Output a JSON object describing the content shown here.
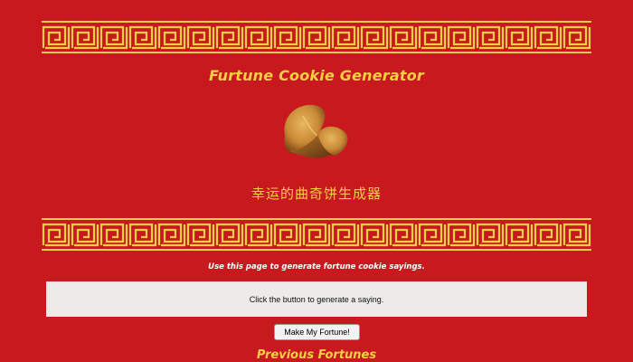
{
  "page": {
    "title": "Furtune Cookie Generator",
    "chinese_title": "幸运的曲奇饼生成器",
    "intro": "Use this page to generate fortune cookie sayings.",
    "saying": "Click the button to generate a saying.",
    "button_label": "Make My Fortune!",
    "previous_title": "Previous Fortunes"
  },
  "colors": {
    "background": "#c8191f",
    "accent_gold": "#f6cf45",
    "saying_box": "#ecebe8"
  },
  "icons": {
    "border": "chinese-fret-border",
    "cookie": "fortune-cookie-image"
  }
}
